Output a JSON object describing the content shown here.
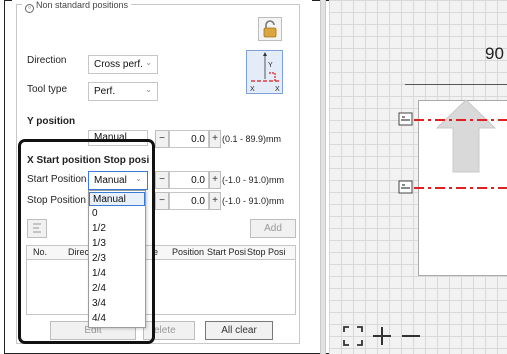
{
  "group": {
    "title": "Non standard positions"
  },
  "form": {
    "direction_label": "Direction",
    "direction_value": "Cross perf.",
    "tool_type_label": "Tool type",
    "tool_type_value": "Perf.",
    "y_position_heading": "Y position",
    "y_position_mode": "Manual",
    "y_position_value": "0.0",
    "y_position_range": "(0.1 - 89.9)mm",
    "x_section_heading": "X Start position Stop positior",
    "start_position_label": "Start Position",
    "start_position_value": "Manual",
    "start_numeric_value": "0.0",
    "start_range": "(-1.0 - 91.0)mm",
    "stop_position_label": "Stop Position",
    "stop_numeric_value": "0.0",
    "stop_range": "(-1.0 - 91.0)mm",
    "minus": "−",
    "plus": "+",
    "add_label": "Add"
  },
  "preview": {
    "y_label": "Y",
    "x_left": "X",
    "x_right": "X"
  },
  "table": {
    "columns": [
      "No.",
      "Direc",
      "e",
      "Position",
      "Start Posi",
      "Stop Posi"
    ]
  },
  "dropdown": {
    "options": [
      "Manual",
      "0",
      "1/2",
      "1/3",
      "2/3",
      "1/4",
      "2/4",
      "3/4",
      "4/4"
    ],
    "selected": "Manual"
  },
  "footer": {
    "edit_label": "Edit",
    "delete_label": "elete",
    "all_clear_label": "All clear"
  },
  "canvas": {
    "ruler_label": "90",
    "fit_icon": "fit-screen-icon",
    "zoom_in_icon": "zoom-in-icon",
    "zoom_out_icon": "zoom-out-icon"
  },
  "colors": {
    "perforation_line": "#e02020",
    "highlight_border": "#111111",
    "selection": "#3a7bd5"
  }
}
